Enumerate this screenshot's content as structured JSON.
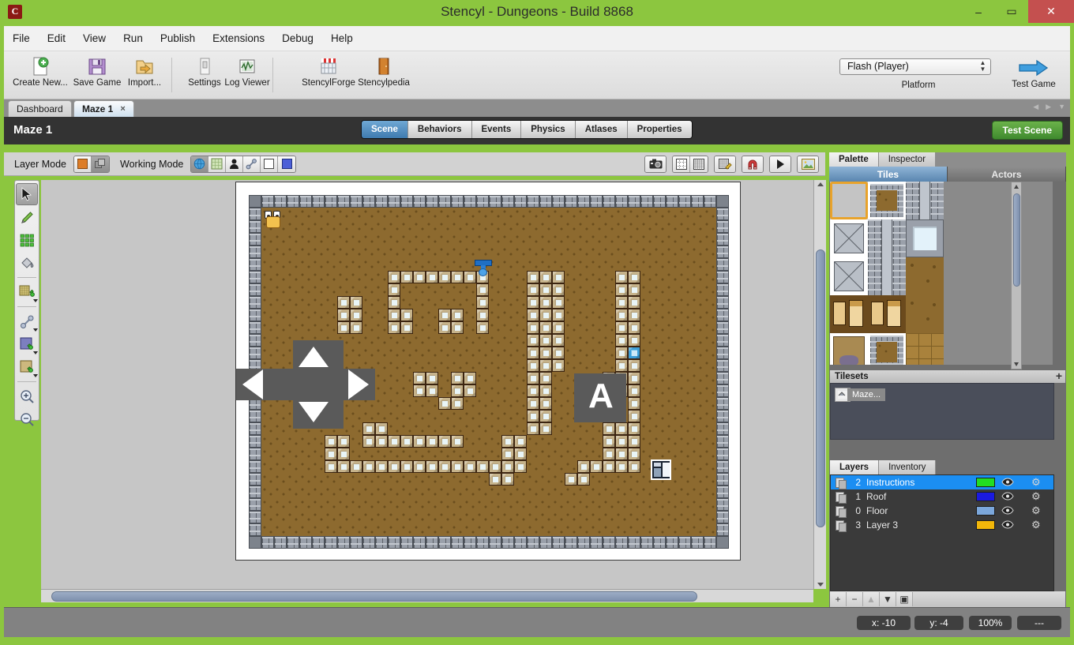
{
  "window": {
    "title": "Stencyl - Dungeons - Build 8868",
    "app_icon": "C",
    "minimize": "–",
    "maximize": "▭",
    "close": "✕"
  },
  "menubar": {
    "items": [
      "File",
      "Edit",
      "View",
      "Run",
      "Publish",
      "Extensions",
      "Debug",
      "Help"
    ]
  },
  "toolbar": {
    "items": [
      {
        "label": "Create New...",
        "icon": "new-document-icon"
      },
      {
        "label": "Save Game",
        "icon": "floppy-disk-icon"
      },
      {
        "label": "Import...",
        "icon": "import-folder-icon"
      },
      {
        "label": "Settings",
        "icon": "settings-switch-icon"
      },
      {
        "label": "Log Viewer",
        "icon": "log-waveform-icon"
      },
      {
        "label": "StencylForge",
        "icon": "storefront-icon"
      },
      {
        "label": "Stencylpedia",
        "icon": "book-icon"
      }
    ],
    "platform_value": "Flash (Player)",
    "platform_label": "Platform",
    "test_game_label": "Test Game"
  },
  "doc_tabs": {
    "items": [
      {
        "label": "Dashboard",
        "active": false,
        "closable": false
      },
      {
        "label": "Maze 1",
        "active": true,
        "closable": true
      }
    ],
    "close_glyph": "×"
  },
  "scene_header": {
    "title": "Maze 1",
    "tabs": [
      "Scene",
      "Behaviors",
      "Events",
      "Physics",
      "Atlases",
      "Properties"
    ],
    "active_tab": "Scene",
    "test_scene_label": "Test Scene"
  },
  "mode_bar": {
    "layer_mode_label": "Layer Mode",
    "layer_mode_buttons": [
      "single-layer-icon",
      "all-layers-icon"
    ],
    "layer_mode_active": 0,
    "working_mode_label": "Working Mode",
    "working_mode_buttons": [
      "scene-globe-icon",
      "terrain-icon",
      "actor-icon",
      "joint-icon",
      "region-icon",
      "collision-box-icon"
    ],
    "working_mode_active": 0,
    "right_buttons": [
      "camera-icon",
      "snap-grid-icon",
      "show-grid-icon",
      "grid-edit-icon",
      "magnet-snap-icon",
      "play-icon",
      "image-icon"
    ]
  },
  "tool_palette": {
    "tools": [
      "select-cursor-icon",
      "pencil-icon",
      "tile-stamp-icon",
      "paint-bucket-icon",
      "terrain-brush-icon",
      "joint-tool-icon",
      "region-blue-icon",
      "region-tan-icon",
      "zoom-in-icon",
      "zoom-out-icon"
    ],
    "active": 0
  },
  "right_panel": {
    "panel_tabs": [
      "Palette",
      "Inspector"
    ],
    "panel_tab_active": "Palette",
    "sub_tabs": [
      "Tiles",
      "Actors"
    ],
    "sub_tab_active": "Tiles",
    "tilesets_header": "Tilesets",
    "tilesets_add": "+",
    "tilesets": [
      {
        "name": "Maze..."
      }
    ],
    "layer_tabs": [
      "Layers",
      "Inventory"
    ],
    "layer_tab_active": "Layers",
    "layers": [
      {
        "num": "2",
        "name": "Instructions",
        "color": "#22dd22",
        "selected": true,
        "visible": true
      },
      {
        "num": "1",
        "name": "Roof",
        "color": "#1a1ae0",
        "selected": false,
        "visible": true
      },
      {
        "num": "0",
        "name": "Floor",
        "color": "#7ba7db",
        "selected": false,
        "visible": true
      },
      {
        "num": "3",
        "name": "Layer 3",
        "color": "#f2b70a",
        "selected": false,
        "visible": true
      }
    ],
    "layer_toolbar": [
      "+",
      "−",
      "▲",
      "▼",
      "▣"
    ]
  },
  "status_bar": {
    "x_value": "x:  -10",
    "y_value": "y:   -4",
    "zoom_value": "100%",
    "extra_value": "---"
  },
  "scene": {
    "overlays": [
      {
        "type": "dpad",
        "label": "dpad-overlay"
      },
      {
        "type": "abutton",
        "label": "A"
      }
    ],
    "actors": [
      {
        "name": "hero-actor",
        "col": 1,
        "row": 1
      },
      {
        "name": "blue-switch-actor",
        "col": 18,
        "row": 4
      }
    ],
    "special_tiles": [
      {
        "name": "cyan-block",
        "col": 30,
        "row": 12
      },
      {
        "name": "window-icon-block",
        "col": 32,
        "row": 21
      }
    ],
    "grid": {
      "cols": 38,
      "rows": 28,
      "tile": 16,
      "block_rows": [
        "0000000000000000000000000000000000000000",
        "0000000000000000000000000000000000000000",
        "0000000000000000000000000000000000000000",
        "0000000001111111100011100001100000000000",
        "0000000001000000100011100001100000000000",
        "0000011001000000100011100001100000000000",
        "0000011001100110100011100001100000000000",
        "0000011001100110100011100001100000000000",
        "0000000000000000000011100001100000000000",
        "0000000000000000000011100001100000000000",
        "0000000000000000000011100001100000000000",
        "0000000000011011000011000011100000000000",
        "0000000000011011000011000011100000000000",
        "0000000000000110000011000000100000000000",
        "0000000000000000000011000000100000000000",
        "0000000110000000000011000011100000000000",
        "0000110111111110001100000011100000000000",
        "0000110000000000001100000011100000000000",
        "0000111111111111111100001111100000000000",
        "0000000000000000011000011000000000000000",
        "0000000000000000000000000000000000000000"
      ]
    }
  }
}
